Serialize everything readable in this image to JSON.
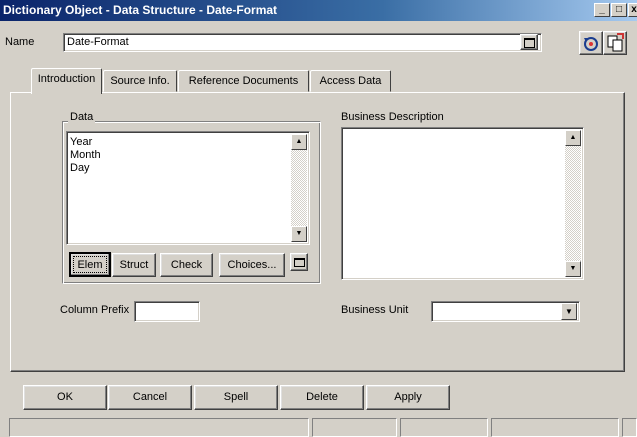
{
  "window": {
    "title": "Dictionary Object - Data Structure - Date-Format",
    "minimize": "_",
    "maximize": "□",
    "close": "x"
  },
  "name_row": {
    "label": "Name",
    "value": "Date-Format"
  },
  "tabs": [
    {
      "label": "Introduction",
      "active": true
    },
    {
      "label": "Source Info.",
      "active": false
    },
    {
      "label": "Reference Documents",
      "active": false
    },
    {
      "label": "Access Data",
      "active": false
    }
  ],
  "data_group": {
    "title": "Data",
    "items": [
      "Year",
      "Month",
      "Day"
    ],
    "buttons": {
      "elem": "Elem",
      "struct": "Struct",
      "check": "Check",
      "choices": "Choices..."
    }
  },
  "business_description": {
    "label": "Business Description",
    "value": ""
  },
  "column_prefix": {
    "label": "Column Prefix",
    "value": ""
  },
  "business_unit": {
    "label": "Business Unit",
    "value": ""
  },
  "footer": {
    "ok": "OK",
    "cancel": "Cancel",
    "spell": "Spell",
    "delete": "Delete",
    "apply": "Apply"
  }
}
